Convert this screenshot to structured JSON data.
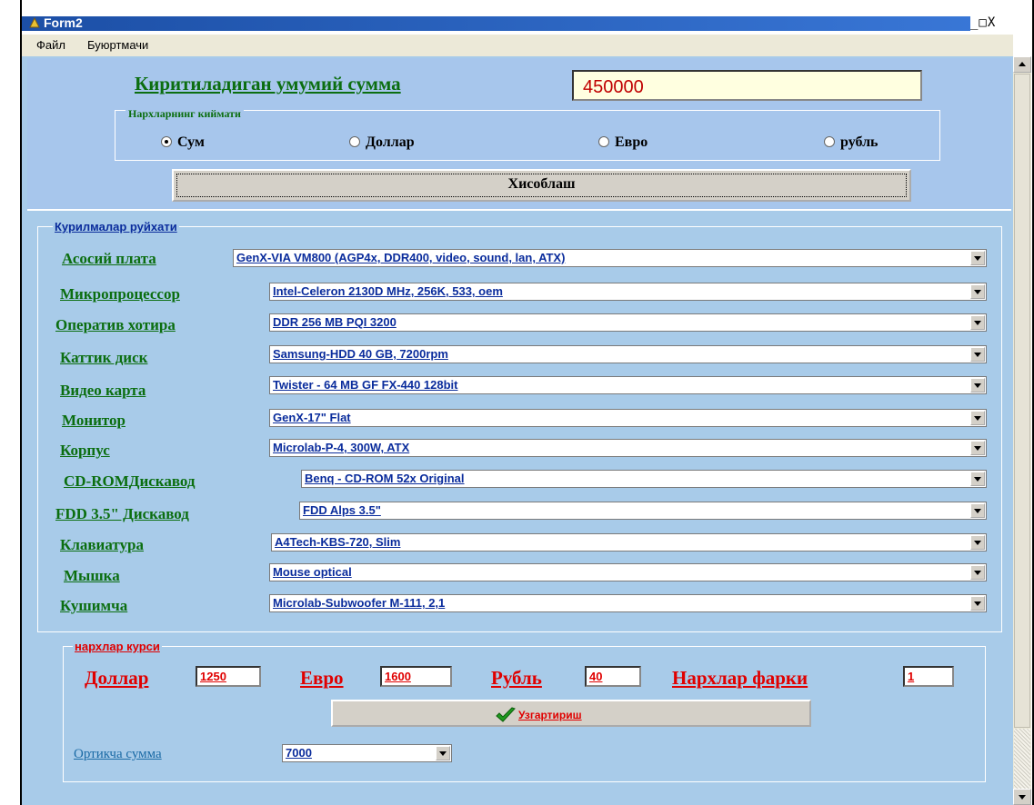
{
  "window": {
    "title": "Form2",
    "controls": "_□X"
  },
  "menu": [
    "Файл",
    "Буюртмачи"
  ],
  "total_sum": {
    "label": "Киритиладиган умумий сумма",
    "value": "450000"
  },
  "price_group": {
    "title": "Нархларнинг киймати",
    "options": [
      "Сум",
      "Доллар",
      "Евро",
      "рубль"
    ],
    "selected": "Сум"
  },
  "calc_button": "Хисоблаш",
  "devices": {
    "title": "Курилмалар руйхати",
    "items": [
      {
        "label": "Асосий плата",
        "value": "GenX-VIA VM800 (AGP4x, DDR400, video, sound, lan, ATX)"
      },
      {
        "label": "Микропроцессор",
        "value": "Intel-Celeron 2130D MHz, 256K, 533, oem"
      },
      {
        "label": "Оператив хотира",
        "value": "DDR 256 MB PQI 3200"
      },
      {
        "label": "Каттик диск",
        "value": "Samsung-HDD 40 GB, 7200rpm"
      },
      {
        "label": "Видео карта",
        "value": "Twister - 64 MB GF FX-440 128bit"
      },
      {
        "label": "Монитор",
        "value": "GenX-17\" Flat"
      },
      {
        "label": "Корпус",
        "value": "Microlab-P-4, 300W, ATX"
      },
      {
        "label": "CD-ROMДискавод",
        "value": "Benq - CD-ROM 52x Original"
      },
      {
        "label": "FDD 3.5\" Дискавод",
        "value": "FDD Alps 3.5\""
      },
      {
        "label": "Клавиатура",
        "value": "A4Tech-KBS-720, Slim"
      },
      {
        "label": "Мышка",
        "value": "Mouse optical"
      },
      {
        "label": "Кушимча",
        "value": "Microlab-Subwoofer M-111, 2,1"
      }
    ]
  },
  "rates": {
    "title": "нархлар курси",
    "dollar": {
      "label": "Доллар",
      "value": "1250"
    },
    "euro": {
      "label": "Евро",
      "value": "1600"
    },
    "ruble": {
      "label": "Рубль",
      "value": "40"
    },
    "diff": {
      "label": "Нархлар фарки",
      "value": "1"
    },
    "change_button": "Узгартириш"
  },
  "extra_sum": {
    "label": "Ортикча сумма",
    "value": "7000"
  },
  "colors": {
    "panel": "#a8cbe9",
    "green_label": "#0b6e10",
    "red_label": "#e00000",
    "blue_value": "#0a2c9c"
  }
}
